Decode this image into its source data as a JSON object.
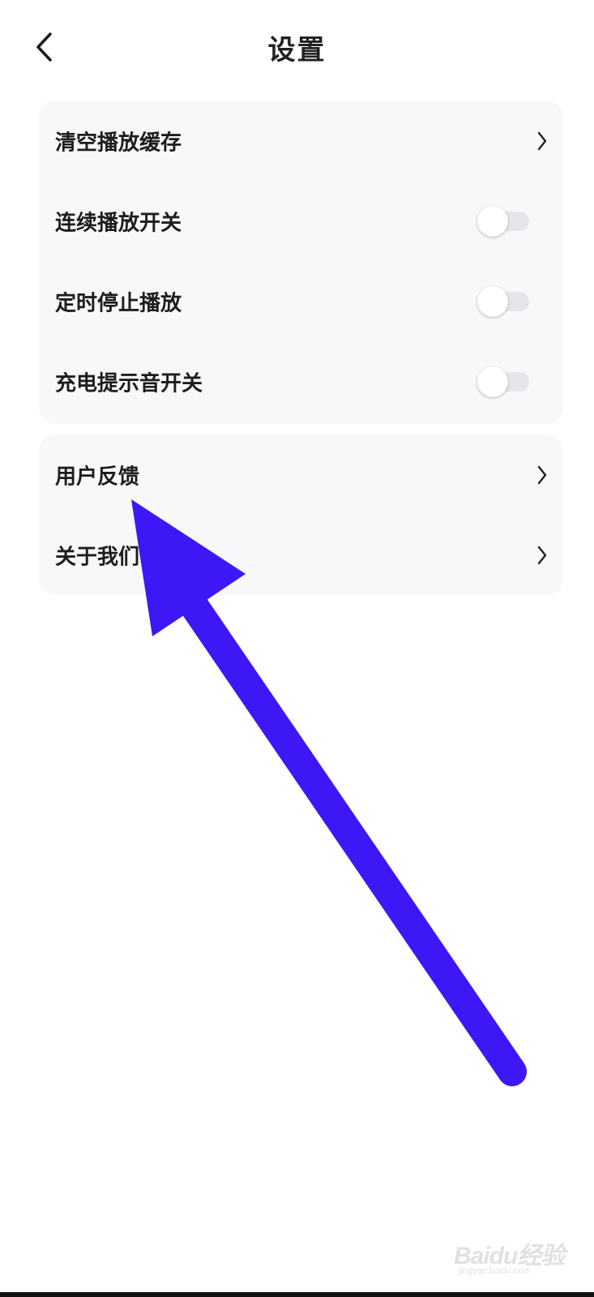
{
  "header": {
    "title": "设置"
  },
  "settings_group_1": {
    "items": [
      {
        "label": "清空播放缓存",
        "control": "chevron"
      },
      {
        "label": "连续播放开关",
        "control": "toggle",
        "on": false
      },
      {
        "label": "定时停止播放",
        "control": "toggle",
        "on": false
      },
      {
        "label": "充电提示音开关",
        "control": "toggle",
        "on": false
      }
    ]
  },
  "settings_group_2": {
    "items": [
      {
        "label": "用户反馈",
        "control": "chevron"
      },
      {
        "label": "关于我们",
        "control": "chevron"
      }
    ]
  },
  "annotation": {
    "arrow_color": "#3d17f5"
  },
  "watermark": {
    "logo_text": "Baidu经验",
    "url_text": "jingyan.baidu.com"
  }
}
